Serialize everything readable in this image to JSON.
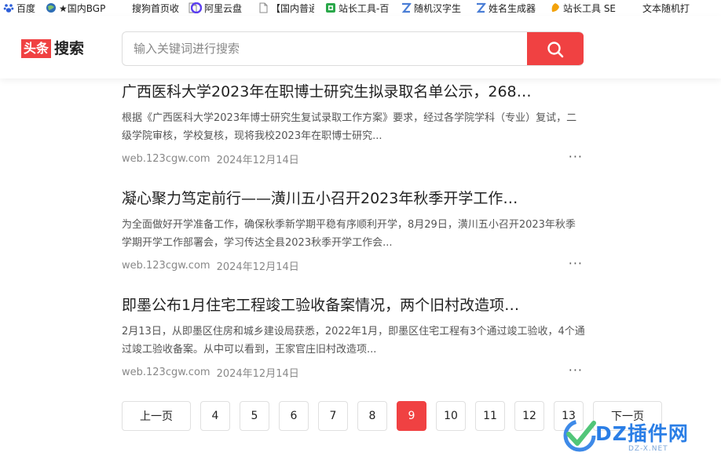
{
  "bookmarks": [
    {
      "label": "百度",
      "icon": "baidu-paw-icon",
      "color": "#2b5dd8"
    },
    {
      "label": "★国内BGP",
      "icon": "globe-icon",
      "color": "#2d6db5"
    },
    {
      "label": "搜狗首页收",
      "icon": "",
      "color": ""
    },
    {
      "label": "",
      "icon": "blank-page-icon",
      "color": "#888888"
    },
    {
      "label": "阿里云盘",
      "icon": "aliyun-drive-icon",
      "color": "#5a3df0"
    },
    {
      "label": "【国内普通",
      "icon": "blank-page-icon",
      "color": "#888888"
    },
    {
      "label": "站长工具-百",
      "icon": "chinaz-icon",
      "color": "#2aa84a"
    },
    {
      "label": "随机汉字生",
      "icon": "z-letter-icon",
      "color": "#4a7ed6"
    },
    {
      "label": "姓名生成器",
      "icon": "z-letter-icon",
      "color": "#4a7ed6"
    },
    {
      "label": "站长工具 SE",
      "icon": "chinaz-icon",
      "color": "#f2a20a"
    },
    {
      "label": "文本随机打",
      "icon": "",
      "color": ""
    }
  ],
  "header": {
    "logo_box": "头条",
    "logo_word": "搜索",
    "search_placeholder": "输入关键词进行搜索",
    "accent": "#f04142"
  },
  "results": [
    {
      "title": "广西医科大学2023年在职博士研究生拟录取名单公示，268…",
      "snippet": "根据《广西医科大学2023年博士研究生复试录取工作方案》要求，经过各学院学科（专业）复试，二级学院审核，学校复核，现将我校2023年在职博士研究...",
      "source": "web.123cgw.com",
      "date": "2024年12月14日",
      "more": "···"
    },
    {
      "title": "凝心聚力笃定前行——潢川五小召开2023年秋季开学工作…",
      "snippet": "为全面做好开学准备工作，确保秋季新学期平稳有序顺利开学，8月29日，潢川五小召开2023年秋季学期开学工作部署会，学习传达全县2023秋季开学工作会...",
      "source": "web.123cgw.com",
      "date": "2024年12月14日",
      "more": "···"
    },
    {
      "title": "即墨公布1月住宅工程竣工验收备案情况，两个旧村改造项…",
      "snippet": "2月13日，从即墨区住房和城乡建设局获悉，2022年1月，即墨区住宅工程有3个通过竣工验收，4个通过竣工验收备案。从中可以看到，王家官庄旧村改造项...",
      "source": "web.123cgw.com",
      "date": "2024年12月14日",
      "more": "···"
    }
  ],
  "pagination": {
    "prev": "上一页",
    "next": "下一页",
    "pages": [
      "4",
      "5",
      "6",
      "7",
      "8",
      "9",
      "10",
      "11",
      "12",
      "13"
    ],
    "current": "9"
  },
  "watermark": {
    "text": "DZ插件网",
    "sub": "DZ-X.NET"
  }
}
